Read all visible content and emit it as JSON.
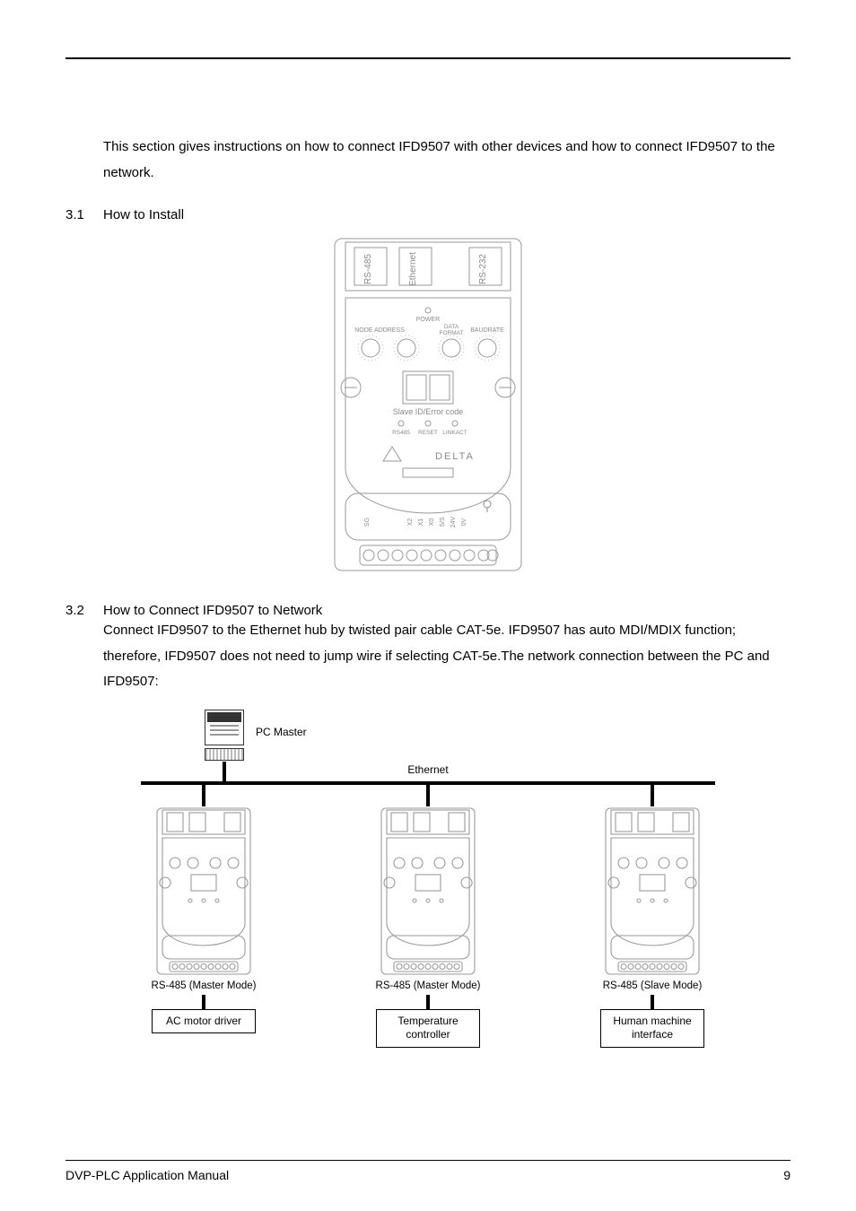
{
  "intro": "This section gives instructions on how to connect IFD9507 with other devices and how to connect IFD9507 to the network.",
  "sections": {
    "s31": {
      "num": "3.1",
      "title": "How to Install"
    },
    "s32": {
      "num": "3.2",
      "title": "How to Connect IFD9507 to Network",
      "body": "Connect IFD9507 to the Ethernet hub by twisted pair cable CAT-5e. IFD9507 has auto MDI/MDIX function; therefore, IFD9507 does not need to jump wire if selecting CAT-5e.The network connection between the PC and IFD9507:"
    }
  },
  "device": {
    "ports": {
      "rs485": "RS-485",
      "ethernet": "Ethernet",
      "rs232": "RS-232"
    },
    "power": "POWER",
    "dials": {
      "node": "NODE ADDRESS",
      "data": "DATA\nFORMAT",
      "baud": "BAUDRATE"
    },
    "display_caption": "Slave ID/Error code",
    "leds": {
      "rs485": "RS485",
      "reset": "RESET",
      "linkact": "LINKACT"
    },
    "brand": "DELTA",
    "terminals": [
      "SG",
      "",
      "",
      "X2",
      "X1",
      "X0",
      "S/S",
      "24V",
      "0V",
      ""
    ]
  },
  "network": {
    "pc_label": "PC Master",
    "ethernet_label": "Ethernet",
    "nodes": [
      {
        "mode": "RS-485 (Master Mode)",
        "box": "AC motor driver"
      },
      {
        "mode": "RS-485 (Master Mode)",
        "box": "Temperature controller"
      },
      {
        "mode": "RS-485 (Slave Mode)",
        "box": "Human machine interface"
      }
    ]
  },
  "footer": {
    "left": "DVP-PLC Application Manual",
    "page": "9"
  }
}
